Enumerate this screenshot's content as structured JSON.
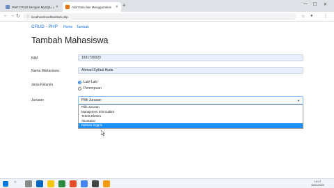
{
  "browser": {
    "tabs": [
      {
        "title": "PHP CRUD Dengan MySQLi dan",
        "active": false
      },
      {
        "title": "Add Data dan Menggunakan",
        "active": true
      }
    ],
    "new_tab": "+",
    "url": "localhost/crud/tambah.php",
    "nav": {
      "back": "←",
      "forward": "→",
      "reload": "↻"
    }
  },
  "app": {
    "brand": "CRUD - PHP",
    "nav_links": [
      "Home",
      "Tambah"
    ]
  },
  "page": {
    "title": "Tambah Mahasiswa",
    "form": {
      "nim_label": "NIM",
      "nim_value": "1931730023",
      "nama_label": "Nama Mahasiswa",
      "nama_value": "Ahmad Syifaul Huda",
      "jk_label": "Jenis Kelamin",
      "jk_options": [
        "Laki-Laki",
        "Perempuan"
      ],
      "jk_selected": "Laki-Laki",
      "jurusan_label": "Jurusan",
      "jurusan_value": "Pilih Jurusan",
      "jurusan_options": [
        "Pilih Jurusan",
        "Manajemen Informatika",
        "Teknik Elektro",
        "Akuntansi",
        "Bahasa Inggris"
      ],
      "jurusan_highlighted": "Bahasa Inggris"
    }
  },
  "taskbar": {
    "time": "10:17",
    "date": "10/01/2020"
  },
  "colors": {
    "accent": "#1a73e8",
    "highlight": "#1e90ff",
    "autofill": "#e8f0fe"
  }
}
